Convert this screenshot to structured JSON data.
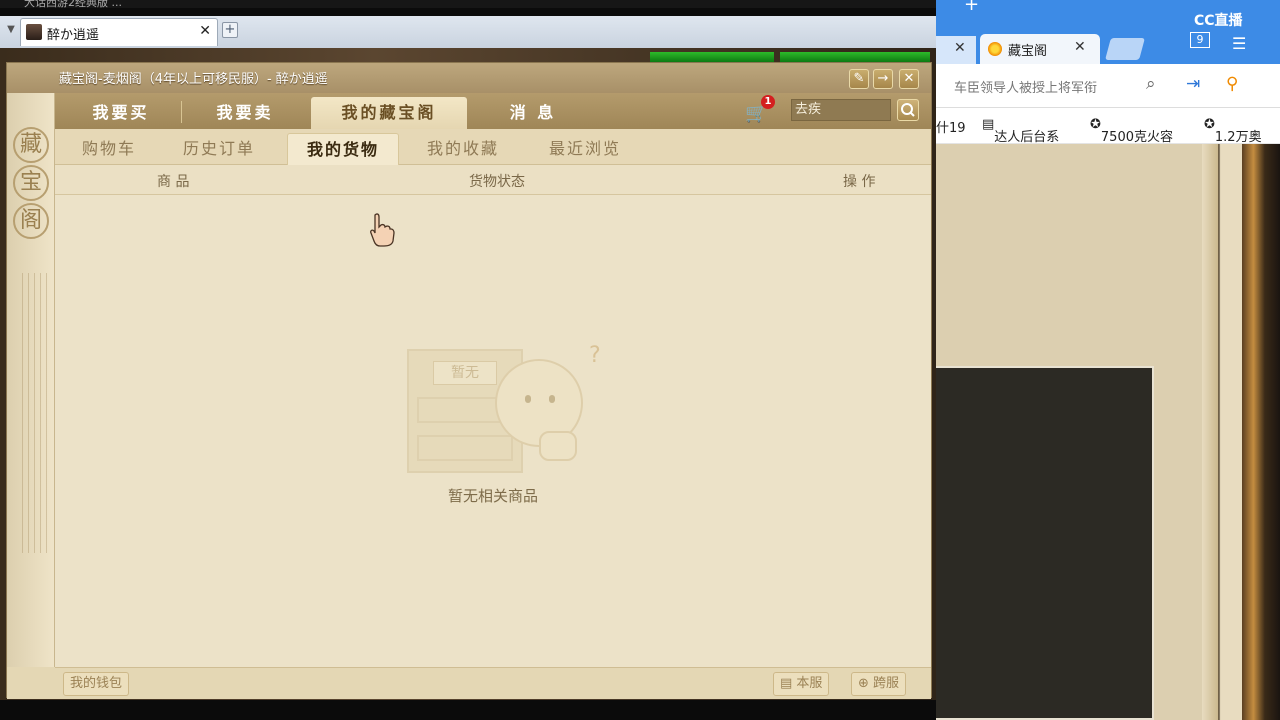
{
  "top_strip": {
    "text": "大话西游2经典版 ..."
  },
  "app_tab": {
    "title": "醉か逍遥"
  },
  "window": {
    "title": "藏宝阁-麦烟阁（4年以上可移民服）- 醉か逍遥",
    "buttons": [
      "✎",
      "→",
      "✕"
    ]
  },
  "side_seals": [
    "藏",
    "宝",
    "阁"
  ],
  "nav_tabs": [
    "我要买",
    "我要卖",
    "我的藏宝阁",
    "消 息"
  ],
  "nav_active": "我的藏宝阁",
  "cart": {
    "count": "1"
  },
  "search": {
    "value": "去疾"
  },
  "sub_tabs": [
    "购物车",
    "历史订单",
    "我的货物",
    "我的收藏",
    "最近浏览"
  ],
  "sub_active": "我的货物",
  "table_headers": {
    "goods": "商 品",
    "status": "货物状态",
    "action": "操 作"
  },
  "empty": {
    "badge": "暂无",
    "message": "暂无相关商品"
  },
  "footer": {
    "wallet": "我的钱包",
    "this_server": "本服",
    "cross_server": "跨服"
  },
  "browser": {
    "tabs": [
      {
        "label": "",
        "close": "✕"
      },
      {
        "label": "藏宝阁",
        "close": "✕"
      }
    ],
    "new_tab": "+",
    "tab_count": "9",
    "brand": "CC直播",
    "address_placeholder": "车臣领导人被授上将军衔",
    "bookmarks": [
      "什19",
      "达人后台系",
      "7500克火容",
      "1.2万奥"
    ]
  }
}
